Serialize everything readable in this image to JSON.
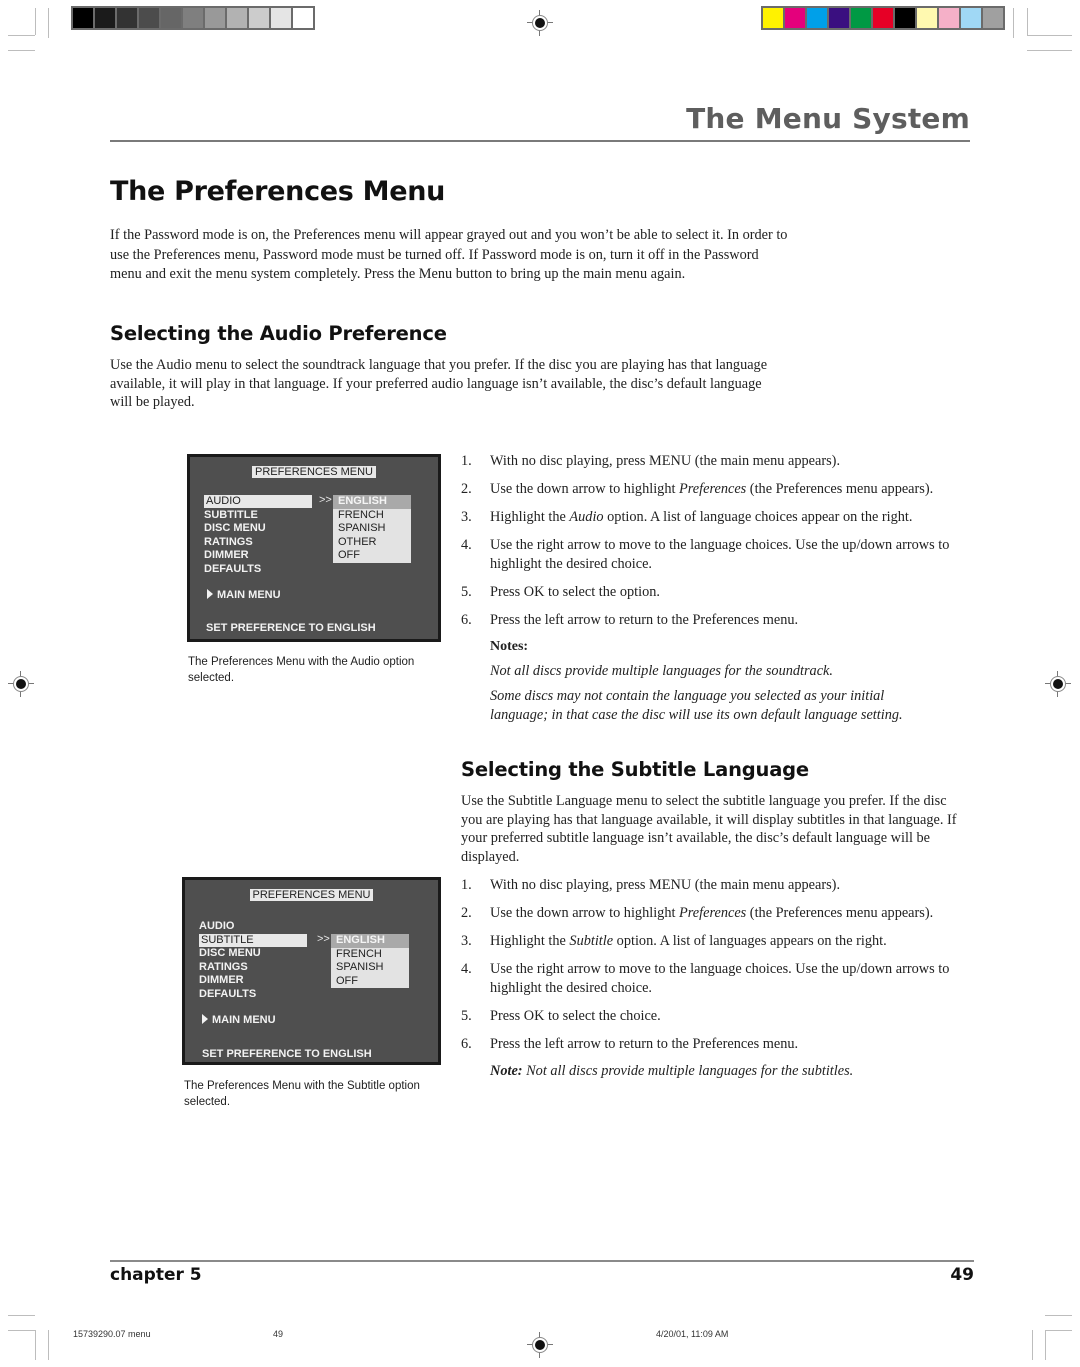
{
  "print_marks": {
    "grayscale_bar": [
      "#000000",
      "#1b1b1b",
      "#333333",
      "#4c4c4c",
      "#666666",
      "#7f7f7f",
      "#999999",
      "#b2b2b2",
      "#cccccc",
      "#e5e5e5",
      "#ffffff"
    ],
    "color_bar": [
      "#fff200",
      "#e4007c",
      "#00a0e9",
      "#3a0f80",
      "#009944",
      "#e60026",
      "#000000",
      "#fff9b0",
      "#f5b0c8",
      "#a0d8f5",
      "#a0a0a0"
    ]
  },
  "header": {
    "section_title": "The Menu System"
  },
  "page_title": "The Preferences Menu",
  "intro_paragraph": "If the Password mode is on, the Preferences menu will appear grayed out and you won’t be able to select it. In order to use the Preferences menu, Password mode must be turned off. If Password mode is on, turn it off in the Password menu and exit the menu system completely. Press the Menu button to bring up the main menu again.",
  "audio_section": {
    "heading": "Selecting the Audio Preference",
    "paragraph": "Use the Audio menu to select the soundtrack language that you prefer. If the disc you are playing has that language available, it will play in that language. If your preferred audio language isn’t available, the disc’s default language will be played.",
    "steps": [
      {
        "num": "1.",
        "before": "With no disc playing, press MENU (the main menu appears).",
        "em": "",
        "after": ""
      },
      {
        "num": "2.",
        "before": "Use the down arrow to highlight ",
        "em": "Preferences",
        "after": " (the Preferences menu appears)."
      },
      {
        "num": "3.",
        "before": "Highlight the ",
        "em": "Audio",
        "after": " option. A list of language choices appear on the right."
      },
      {
        "num": "4.",
        "before": "Use the right arrow to move to the language choices. Use the up/down arrows to highlight the desired choice.",
        "em": "",
        "after": ""
      },
      {
        "num": "5.",
        "before": "Press OK to select the option.",
        "em": "",
        "after": ""
      },
      {
        "num": "6.",
        "before": "Press the left arrow to return to the Preferences menu.",
        "em": "",
        "after": ""
      }
    ],
    "notes_heading": "Notes:",
    "notes": [
      "Not all discs provide multiple languages for the soundtrack.",
      "Some discs may not contain the language you selected as your initial language; in that case the disc will use its own default language setting."
    ],
    "screen": {
      "title": "PREFERENCES MENU",
      "items": [
        "AUDIO",
        "SUBTITLE",
        "DISC MENU",
        "RATINGS",
        "DIMMER",
        "DEFAULTS"
      ],
      "selected_item": "AUDIO",
      "arrows": ">>",
      "languages": [
        "ENGLISH",
        "FRENCH",
        "SPANISH",
        "OTHER",
        "OFF"
      ],
      "highlighted_language": "ENGLISH",
      "main_menu": "MAIN MENU",
      "status": "SET PREFERENCE TO ENGLISH"
    },
    "caption": "The Preferences Menu with the Audio option selected."
  },
  "subtitle_section": {
    "heading": "Selecting the Subtitle Language",
    "paragraph": "Use the Subtitle Language menu to select the subtitle language you prefer.  If the disc you are playing has that language available, it will display subtitles in that language. If your preferred subtitle language isn’t available, the disc’s default language will be displayed.",
    "steps": [
      {
        "num": "1.",
        "before": "With no disc playing, press MENU (the main menu appears).",
        "em": "",
        "after": ""
      },
      {
        "num": "2.",
        "before": "Use the down arrow to highlight ",
        "em": "Preferences",
        "after": " (the Preferences menu appears)."
      },
      {
        "num": "3.",
        "before": "Highlight the ",
        "em": "Subtitle",
        "after": " option. A list of languages appears on the right."
      },
      {
        "num": "4.",
        "before": "Use the right arrow to move to the language choices. Use the up/down arrows to highlight the desired choice.",
        "em": "",
        "after": ""
      },
      {
        "num": "5.",
        "before": "Press OK to select the choice.",
        "em": "",
        "after": ""
      },
      {
        "num": "6.",
        "before": "Press the left arrow to return to the Preferences menu.",
        "em": "",
        "after": ""
      }
    ],
    "note_label": "Note:",
    "note_text": " Not all discs provide multiple languages for the subtitles.",
    "screen": {
      "title": "PREFERENCES MENU",
      "items": [
        "AUDIO",
        "SUBTITLE",
        "DISC MENU",
        "RATINGS",
        "DIMMER",
        "DEFAULTS"
      ],
      "selected_item": "SUBTITLE",
      "arrows": ">>",
      "languages": [
        "ENGLISH",
        "FRENCH",
        "SPANISH",
        "OFF"
      ],
      "highlighted_language": "ENGLISH",
      "main_menu": "MAIN MENU",
      "status": "SET PREFERENCE TO ENGLISH"
    },
    "caption": "The Preferences Menu with the Subtitle option selected."
  },
  "footer": {
    "chapter_label": "chapter 5",
    "page_number": "49",
    "slug_file": "15739290.07 menu",
    "slug_page": "49",
    "slug_date": "4/20/01, 11:09 AM"
  }
}
